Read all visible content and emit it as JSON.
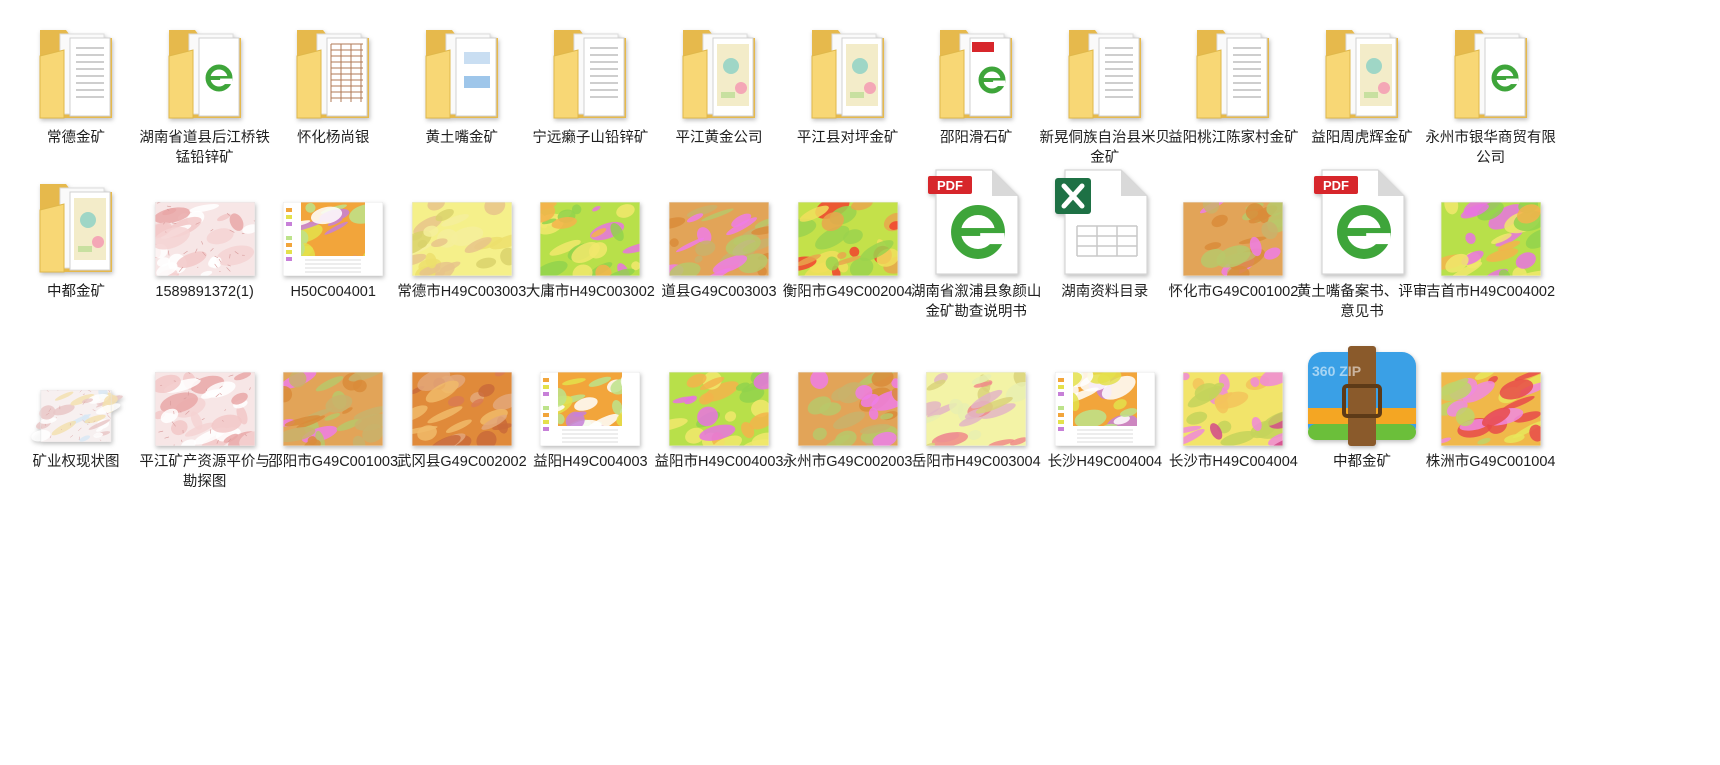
{
  "colors": {
    "folder_front": "#f8d775",
    "folder_back": "#e6b94c",
    "ie_green": "#3ea53a",
    "pdf_red": "#d7262b",
    "excel_green": "#1e7145",
    "zip_blue": "#3aa0e6",
    "zip_strap": "#8a5a2b"
  },
  "items": [
    {
      "label": "常德金矿",
      "type": "folder",
      "content": "doc"
    },
    {
      "label": "湖南省道县后江桥铁锰铅锌矿",
      "type": "folder",
      "content": "ie"
    },
    {
      "label": "怀化杨尚银",
      "type": "folder",
      "content": "table"
    },
    {
      "label": "黄土嘴金矿",
      "type": "folder",
      "content": "blue"
    },
    {
      "label": "宁远癞子山铅锌矿",
      "type": "folder",
      "content": "doc"
    },
    {
      "label": "平江黄金公司",
      "type": "folder",
      "content": "map"
    },
    {
      "label": "平江县对坪金矿",
      "type": "folder",
      "content": "map"
    },
    {
      "label": "邵阳滑石矿",
      "type": "folder",
      "content": "pdf"
    },
    {
      "label": "新晃侗族自治县米贝金矿",
      "type": "folder",
      "content": "doc"
    },
    {
      "label": "益阳桃江陈家村金矿",
      "type": "folder",
      "content": "doc"
    },
    {
      "label": "益阳周虎辉金矿",
      "type": "folder",
      "content": "map"
    },
    {
      "label": "永州市银华商贸有限公司",
      "type": "folder",
      "content": "ie"
    },
    {
      "label": "中都金矿",
      "type": "folder",
      "content": "map"
    },
    {
      "label": "1589891372(1)",
      "type": "image",
      "palette": "pink_map"
    },
    {
      "label": "H50C004001",
      "type": "image",
      "palette": "legend_map"
    },
    {
      "label": "常德市H49C003003",
      "type": "image",
      "palette": "yellow"
    },
    {
      "label": "大庸市H49C003002",
      "type": "image",
      "palette": "green_pink"
    },
    {
      "label": "道县G49C003003",
      "type": "image",
      "palette": "orange_pink"
    },
    {
      "label": "衡阳市G49C002004",
      "type": "image",
      "palette": "green_red"
    },
    {
      "label": "湖南省溆浦县象颜山金矿勘查说明书",
      "type": "pdf"
    },
    {
      "label": "湖南资料目录",
      "type": "excel"
    },
    {
      "label": "怀化市G49C001002",
      "type": "image",
      "palette": "orange_pink"
    },
    {
      "label": "黄土嘴备案书、评审意见书",
      "type": "pdf"
    },
    {
      "label": "吉首市H49C004002",
      "type": "image",
      "palette": "green_pink"
    },
    {
      "label": "矿业权现状图",
      "type": "image",
      "palette": "small_map"
    },
    {
      "label": "平江矿产资源平价与勘探图",
      "type": "image",
      "palette": "pink_map"
    },
    {
      "label": "邵阳市G49C001003",
      "type": "image",
      "palette": "orange_pink"
    },
    {
      "label": "武冈县G49C002002",
      "type": "image",
      "palette": "orange_brown"
    },
    {
      "label": "益阳H49C004003",
      "type": "image",
      "palette": "legend_map"
    },
    {
      "label": "益阳市H49C004003",
      "type": "image",
      "palette": "green_pink"
    },
    {
      "label": "永州市G49C002003",
      "type": "image",
      "palette": "orange_pink"
    },
    {
      "label": "岳阳市H49C003004",
      "type": "image",
      "palette": "yellow_red"
    },
    {
      "label": "长沙H49C004004",
      "type": "image",
      "palette": "legend_map"
    },
    {
      "label": "长沙市H49C004004",
      "type": "image",
      "palette": "yellow_pink"
    },
    {
      "label": "中都金矿",
      "type": "zip",
      "zip_text": "360 ZIP"
    },
    {
      "label": "株洲市G49C001004",
      "type": "image",
      "palette": "orange_red"
    }
  ]
}
